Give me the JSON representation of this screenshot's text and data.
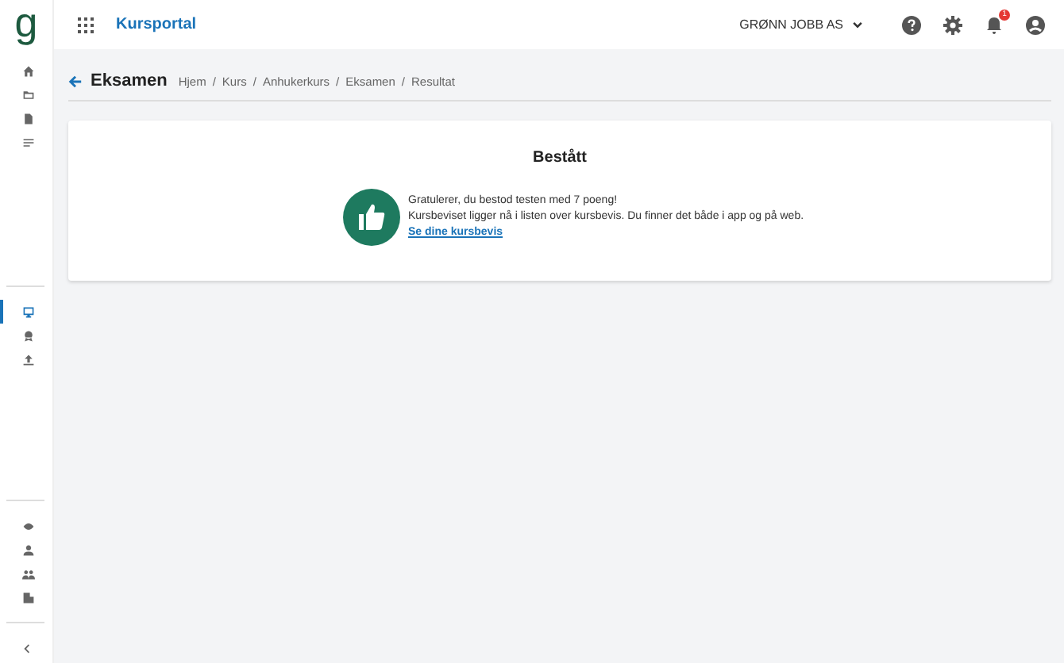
{
  "logo": "g",
  "app_title": "Kursportal",
  "header": {
    "company": "GRØNN JOBB AS",
    "notification_count": "1"
  },
  "sidebar": {
    "groups": [
      {
        "items": [
          {
            "kind": "home",
            "selected": false
          },
          {
            "kind": "folder",
            "selected": false
          },
          {
            "kind": "document",
            "selected": false
          },
          {
            "kind": "list",
            "selected": false
          }
        ]
      },
      {
        "items": [
          {
            "kind": "monitor",
            "selected": true
          },
          {
            "kind": "award",
            "selected": false
          },
          {
            "kind": "upload",
            "selected": false
          }
        ]
      },
      {
        "items": [
          {
            "kind": "eye",
            "selected": false
          },
          {
            "kind": "person",
            "selected": false
          },
          {
            "kind": "people",
            "selected": false
          },
          {
            "kind": "building",
            "selected": false
          }
        ]
      }
    ]
  },
  "page": {
    "title": "Eksamen",
    "breadcrumb_separator": "/",
    "breadcrumb": [
      "Hjem",
      "Kurs",
      "Anhukerkurs",
      "Eksamen",
      "Resultat"
    ]
  },
  "result": {
    "title": "Bestått",
    "lines": [
      "Gratulerer, du bestod testen med 7 poeng!",
      "Kursbeviset ligger nå i listen over kursbevis. Du finner det både i app og på web."
    ],
    "link": "Se dine kursbevis"
  }
}
